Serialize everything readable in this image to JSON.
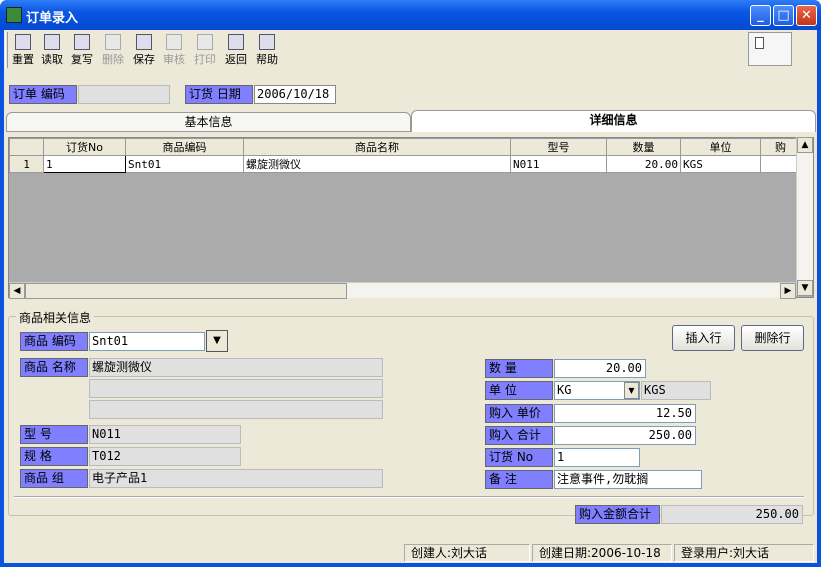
{
  "window": {
    "title": "订单录入"
  },
  "toolbar": {
    "reset": "重置",
    "read": "读取",
    "copy": "复写",
    "delete": "删除",
    "save": "保存",
    "approve": "审核",
    "print": "打印",
    "back": "返回",
    "help": "帮助"
  },
  "header": {
    "order_no_label": "订单 编码",
    "order_no_value": "",
    "order_date_label": "订货 日期",
    "order_date_value": "2006/10/18"
  },
  "tabs": {
    "basic": "基本信息",
    "detail": "详细信息"
  },
  "grid": {
    "columns": [
      "订货No",
      "商品编码",
      "商品名称",
      "型号",
      "数量",
      "单位",
      "购"
    ],
    "rows": [
      {
        "index": "1",
        "order_no": "1",
        "product_code": "Snt01",
        "product_name": "螺旋测微仪",
        "model": "N011",
        "quantity": "20.00",
        "unit": "KGS",
        "extra": ""
      }
    ]
  },
  "product": {
    "section_title": "商品相关信息",
    "code_label": "商品 编码",
    "code_value": "Snt01",
    "name_label": "商品 名称",
    "name_value": "螺旋测微仪",
    "name_value2": "",
    "name_value3": "",
    "model_label": "型 号",
    "model_value": "N011",
    "spec_label": "规 格",
    "spec_value": "T012",
    "group_label": "商品 组",
    "group_value": "电子产品1",
    "insert_row": "插入行",
    "delete_row": "删除行",
    "qty_label": "数 量",
    "qty_value": "20.00",
    "unit_label": "单 位",
    "unit_value": "KG",
    "unit_desc": "KGS",
    "price_label": "购入 单价",
    "price_value": "12.50",
    "total_label": "购入 合计",
    "total_value": "250.00",
    "orderno_label": "订货 No",
    "orderno_value": "1",
    "remark_label": "备 注",
    "remark_value": "注意事件,勿耽搁"
  },
  "footer": {
    "grand_total_label": "购入金额合计",
    "grand_total_value": "250.00"
  },
  "status": {
    "creator": "创建人:刘大话",
    "created_date": "创建日期:2006-10-18",
    "login_user": "登录用户:刘大话"
  },
  "colors": {
    "label_bg": "#7f7fff",
    "titlebar": "#0a56e4",
    "window_bg": "#ece9d8"
  }
}
